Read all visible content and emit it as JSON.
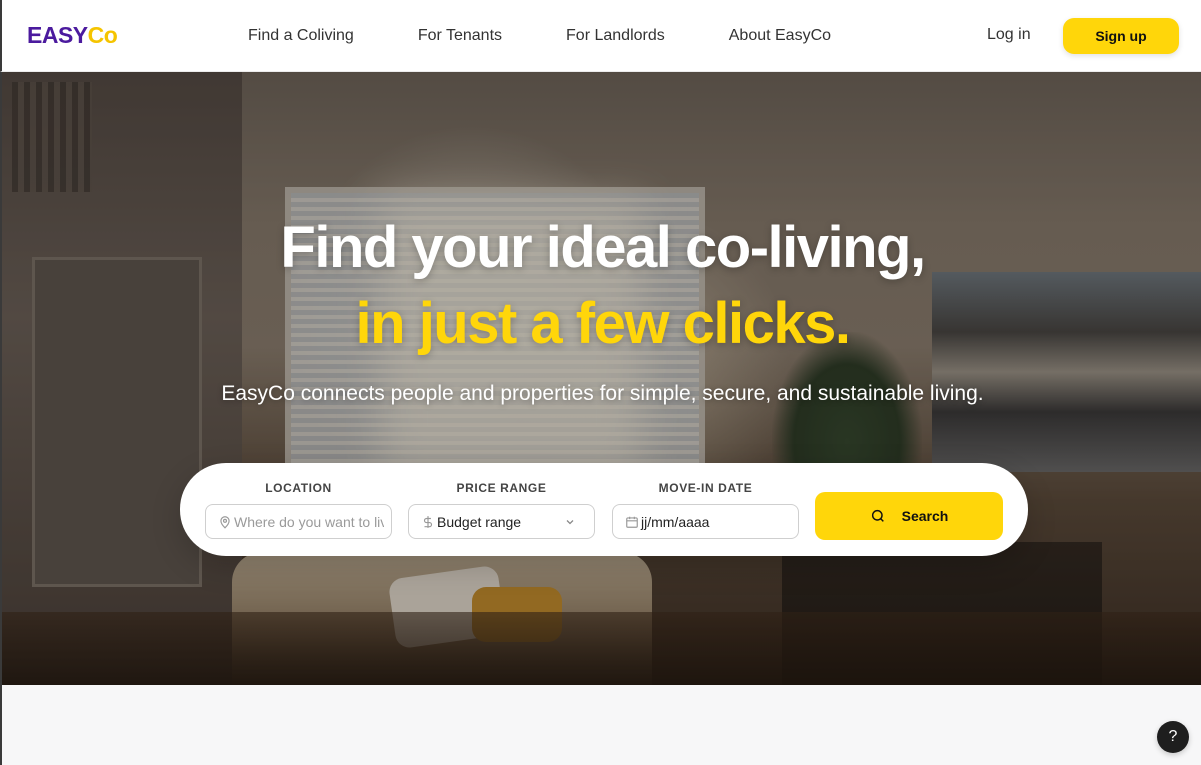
{
  "brand": {
    "part1": "EASY",
    "part2": "Co",
    "primary_color": "#4b1a9e",
    "accent_color": "#ffd60a"
  },
  "nav": {
    "links": [
      {
        "label": "Find a Coliving"
      },
      {
        "label": "For Tenants"
      },
      {
        "label": "For Landlords"
      },
      {
        "label": "About EasyCo"
      }
    ],
    "login_label": "Log in",
    "signup_label": "Sign up"
  },
  "hero": {
    "title_line1": "Find your ideal co-living,",
    "title_line2": "in just a few clicks.",
    "subtitle": "EasyCo connects people and properties for simple, secure, and sustainable living."
  },
  "search": {
    "location_label": "LOCATION",
    "location_placeholder": "Where do you want to live?",
    "location_icon": "map-pin-icon",
    "price_label": "PRICE RANGE",
    "price_value": "Budget range",
    "price_icon": "dollar-icon",
    "date_label": "MOVE-IN DATE",
    "date_value": "jj/mm/aaaa",
    "date_icon": "calendar-icon",
    "button_label": "Search",
    "button_icon": "search-icon"
  },
  "help": {
    "label": "?"
  }
}
